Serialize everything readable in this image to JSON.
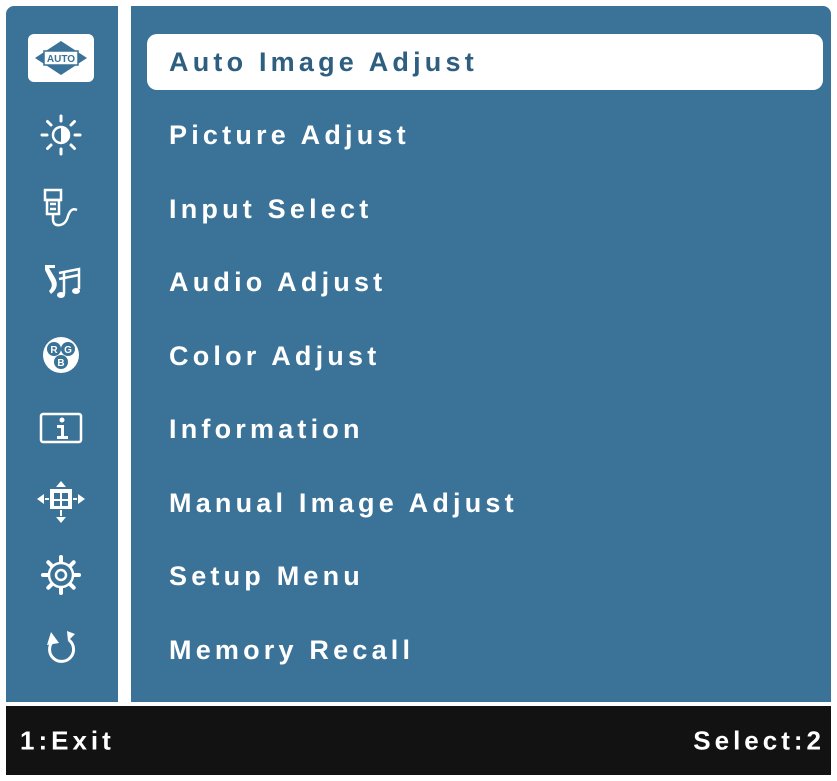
{
  "menu": {
    "items": [
      {
        "label": "Auto Image Adjust",
        "icon": "auto-icon",
        "selected": true
      },
      {
        "label": "Picture Adjust",
        "icon": "brightness-icon",
        "selected": false
      },
      {
        "label": "Input Select",
        "icon": "input-icon",
        "selected": false
      },
      {
        "label": "Audio Adjust",
        "icon": "audio-icon",
        "selected": false
      },
      {
        "label": "Color Adjust",
        "icon": "rgb-color-icon",
        "selected": false
      },
      {
        "label": "Information",
        "icon": "info-icon",
        "selected": false
      },
      {
        "label": "Manual Image Adjust",
        "icon": "manual-image-icon",
        "selected": false
      },
      {
        "label": "Setup Menu",
        "icon": "gear-icon",
        "selected": false
      },
      {
        "label": "Memory Recall",
        "icon": "recall-icon",
        "selected": false
      }
    ]
  },
  "auto_icon_text": "AUTO",
  "rgb_letters": [
    "R",
    "G",
    "B"
  ],
  "footer": {
    "exit_label": "1:Exit",
    "select_label": "Select:2"
  },
  "colors": {
    "panel": "#3a7298",
    "selected_bg": "#ffffff",
    "selected_text": "#2f5f80",
    "footer_bg": "#121212"
  }
}
